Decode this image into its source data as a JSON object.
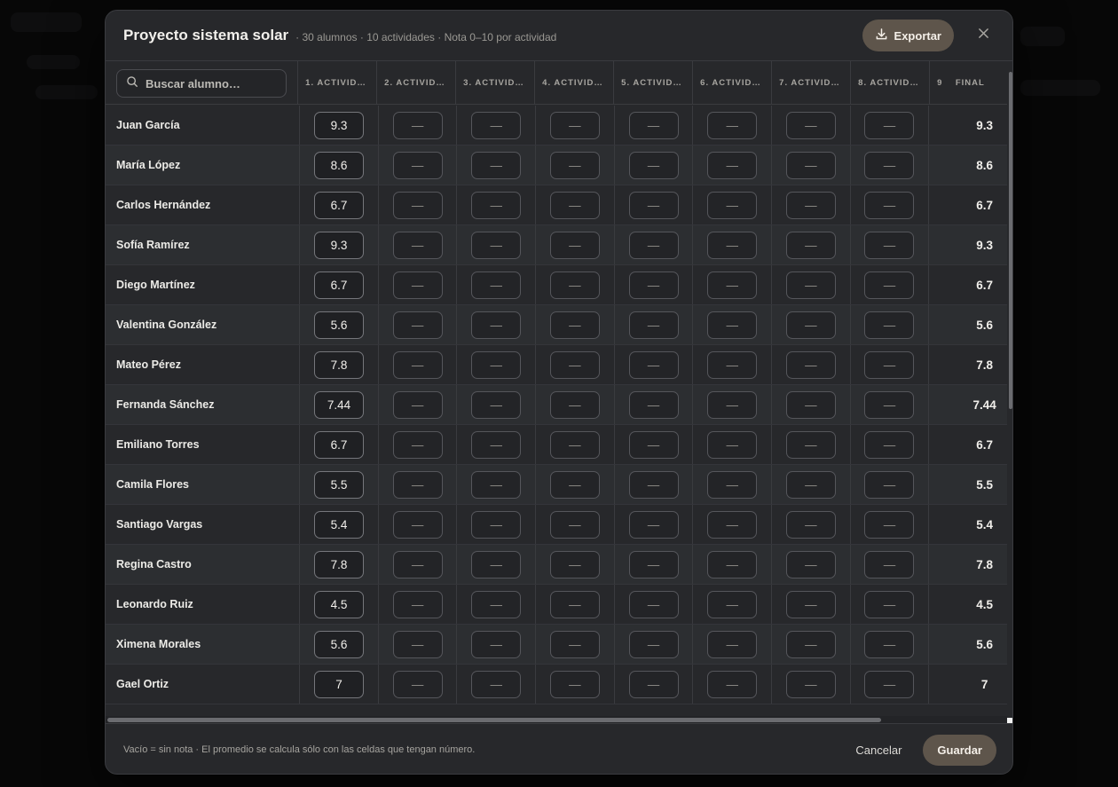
{
  "modal": {
    "title": "Proyecto sistema solar",
    "meta": "· 30 alumnos · 10 actividades · Nota 0–10 por actividad",
    "export_label": "Exportar"
  },
  "search": {
    "placeholder": "Buscar alumno…"
  },
  "columns": {
    "activities": [
      "1. ACTIVIDAD…",
      "2. ACTIVIDAD…",
      "3. ACTIVIDAD…",
      "4. ACTIVIDAD…",
      "5. ACTIVIDAD…",
      "6. ACTIVIDAD…",
      "7. ACTIVIDAD…",
      "8. ACTIVIDAD…"
    ],
    "col9": "9",
    "final": "FINAL"
  },
  "empty_mark": "—",
  "students": [
    {
      "name": "Juan García",
      "grade1": "9.3",
      "final": "9.3"
    },
    {
      "name": "María López",
      "grade1": "8.6",
      "final": "8.6"
    },
    {
      "name": "Carlos Hernández",
      "grade1": "6.7",
      "final": "6.7"
    },
    {
      "name": "Sofía Ramírez",
      "grade1": "9.3",
      "final": "9.3"
    },
    {
      "name": "Diego Martínez",
      "grade1": "6.7",
      "final": "6.7"
    },
    {
      "name": "Valentina González",
      "grade1": "5.6",
      "final": "5.6"
    },
    {
      "name": "Mateo Pérez",
      "grade1": "7.8",
      "final": "7.8"
    },
    {
      "name": "Fernanda Sánchez",
      "grade1": "7.44",
      "final": "7.44"
    },
    {
      "name": "Emiliano Torres",
      "grade1": "6.7",
      "final": "6.7"
    },
    {
      "name": "Camila Flores",
      "grade1": "5.5",
      "final": "5.5"
    },
    {
      "name": "Santiago Vargas",
      "grade1": "5.4",
      "final": "5.4"
    },
    {
      "name": "Regina Castro",
      "grade1": "7.8",
      "final": "7.8"
    },
    {
      "name": "Leonardo Ruiz",
      "grade1": "4.5",
      "final": "4.5"
    },
    {
      "name": "Ximena Morales",
      "grade1": "5.6",
      "final": "5.6"
    },
    {
      "name": "Gael Ortiz",
      "grade1": "7",
      "final": "7"
    }
  ],
  "footer": {
    "note": "Vacío = sin nota · El promedio se calcula sólo con las celdas que tengan número.",
    "cancel_label": "Cancelar",
    "save_label": "Guardar"
  },
  "colors": {
    "accent": "#5e554b",
    "surface": "#27282b",
    "border": "#3a3b3f"
  },
  "icons": {
    "export": "download-icon",
    "close": "close-icon",
    "search": "search-icon"
  }
}
